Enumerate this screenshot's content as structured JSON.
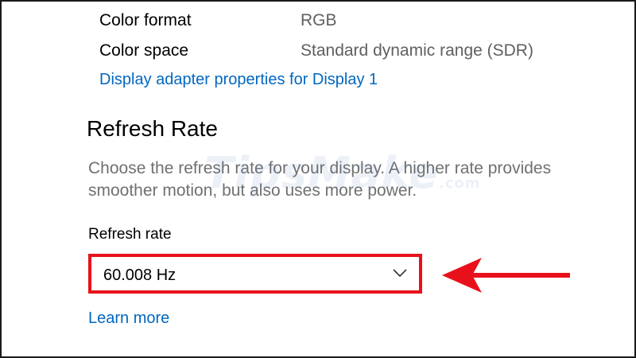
{
  "display_info": {
    "color_format_label": "Color format",
    "color_format_value": "RGB",
    "color_space_label": "Color space",
    "color_space_value": "Standard dynamic range (SDR)",
    "adapter_link": "Display adapter properties for Display 1"
  },
  "refresh_rate_section": {
    "title": "Refresh Rate",
    "description": "Choose the refresh rate for your display. A higher rate provides smoother motion, but also uses more power.",
    "field_label": "Refresh rate",
    "selected_value": "60.008 Hz",
    "learn_more_link": "Learn more"
  },
  "watermark": {
    "text": "TipsMake",
    "suffix": ".com"
  },
  "annotation": {
    "highlight_color": "#e8111b",
    "arrow_icon": "red-arrow-left-icon"
  },
  "colors": {
    "link": "#0067c0",
    "secondary_text": "#5f5f5f",
    "description_text": "#707070"
  }
}
